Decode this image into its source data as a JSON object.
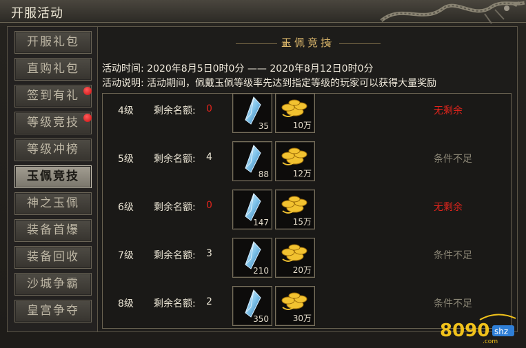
{
  "window": {
    "title": "开服活动"
  },
  "sidebar": {
    "tabs": [
      {
        "label": "开服礼包",
        "active": false,
        "dot": false
      },
      {
        "label": "直购礼包",
        "active": false,
        "dot": false
      },
      {
        "label": "签到有礼",
        "active": false,
        "dot": true
      },
      {
        "label": "等级竞技",
        "active": false,
        "dot": true
      },
      {
        "label": "等级冲榜",
        "active": false,
        "dot": false
      },
      {
        "label": "玉佩竞技",
        "active": true,
        "dot": false
      },
      {
        "label": "神之玉佩",
        "active": false,
        "dot": false
      },
      {
        "label": "装备首爆",
        "active": false,
        "dot": false
      },
      {
        "label": "装备回收",
        "active": false,
        "dot": false
      },
      {
        "label": "沙城争霸",
        "active": false,
        "dot": false
      },
      {
        "label": "皇宫争夺",
        "active": false,
        "dot": false
      }
    ]
  },
  "panel": {
    "header": "玉佩竞技",
    "time_line": "活动时间: 2020年8月5日0时0分 —— 2020年8月12日0时0分",
    "desc_line": "活动说明: 活动期间，佩戴玉佩等级率先达到指定等级的玩家可以获得大量奖励",
    "quota_label": "剩余名额:"
  },
  "rows": [
    {
      "level": "4级",
      "quota": "0",
      "crystal": "35",
      "gold": "10万",
      "status": "无剩余"
    },
    {
      "level": "5级",
      "quota": "4",
      "crystal": "88",
      "gold": "12万",
      "status": "条件不足"
    },
    {
      "level": "6级",
      "quota": "0",
      "crystal": "147",
      "gold": "15万",
      "status": "无剩余"
    },
    {
      "level": "7级",
      "quota": "3",
      "crystal": "210",
      "gold": "20万",
      "status": "条件不足"
    },
    {
      "level": "8级",
      "quota": "2",
      "crystal": "350",
      "gold": "30万",
      "status": "条件不足"
    }
  ],
  "colors": {
    "red": "#e0241c",
    "muted": "#8a8575",
    "white": "#e8e2d2",
    "gold": "#d8b46a"
  },
  "icons": {
    "reward1": "crystal-icon",
    "reward2": "gold-ingot-icon",
    "decor": "dragon-icon"
  },
  "watermark": {
    "brand": "8090",
    "sub": "shz",
    "domain": ".com"
  }
}
